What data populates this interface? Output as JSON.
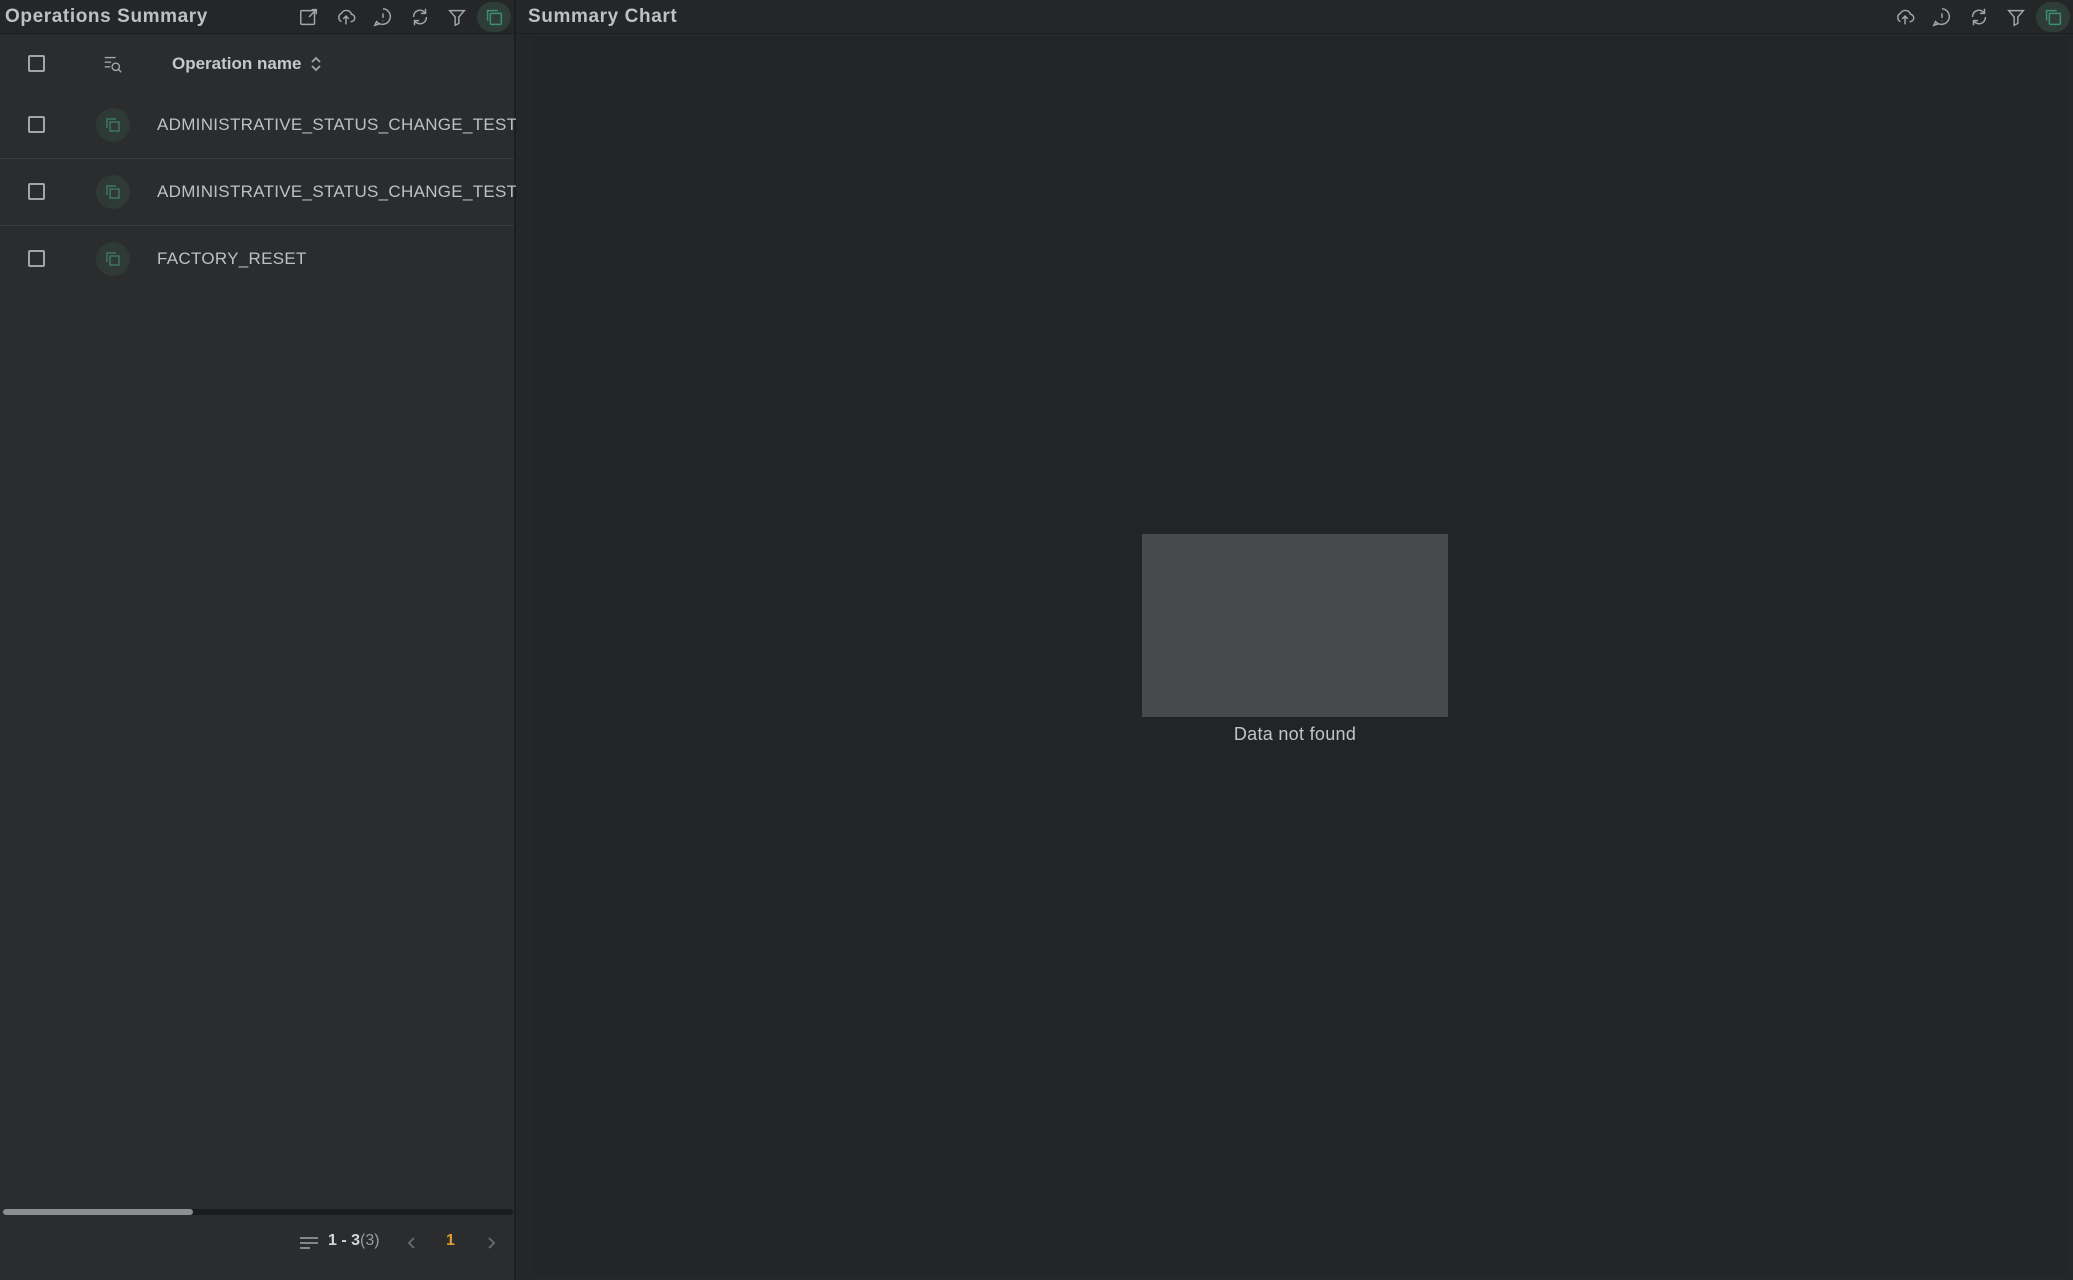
{
  "left_panel": {
    "title": "Operations Summary",
    "toolbar": [
      "export-icon",
      "upload-icon",
      "info-icon",
      "refresh-icon",
      "filter-icon",
      "multiselect-icon"
    ],
    "table": {
      "columns": [
        "Operation name"
      ],
      "rows": [
        {
          "name": "ADMINISTRATIVE_STATUS_CHANGE_TEST"
        },
        {
          "name": "ADMINISTRATIVE_STATUS_CHANGE_TEST_"
        },
        {
          "name": "FACTORY_RESET"
        }
      ]
    },
    "pagination": {
      "range": "1 - 3",
      "total": "(3)",
      "current_page": "1"
    }
  },
  "right_panel": {
    "title": "Summary Chart",
    "toolbar": [
      "upload-icon",
      "info-icon",
      "refresh-icon",
      "filter-icon",
      "multiselect-icon"
    ],
    "empty_state": "Data not found"
  },
  "colors": {
    "accent": "#3d8f70",
    "page_active": "#e59b2e"
  }
}
